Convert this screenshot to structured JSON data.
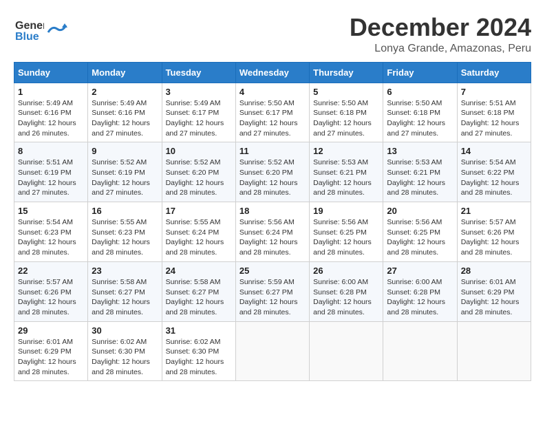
{
  "header": {
    "logo_line1": "General",
    "logo_line2": "Blue",
    "main_title": "December 2024",
    "subtitle": "Lonya Grande, Amazonas, Peru"
  },
  "calendar": {
    "days_of_week": [
      "Sunday",
      "Monday",
      "Tuesday",
      "Wednesday",
      "Thursday",
      "Friday",
      "Saturday"
    ],
    "weeks": [
      [
        {
          "day": "",
          "info": ""
        },
        {
          "day": "2",
          "info": "Sunrise: 5:49 AM\nSunset: 6:16 PM\nDaylight: 12 hours\nand 27 minutes."
        },
        {
          "day": "3",
          "info": "Sunrise: 5:49 AM\nSunset: 6:17 PM\nDaylight: 12 hours\nand 27 minutes."
        },
        {
          "day": "4",
          "info": "Sunrise: 5:50 AM\nSunset: 6:17 PM\nDaylight: 12 hours\nand 27 minutes."
        },
        {
          "day": "5",
          "info": "Sunrise: 5:50 AM\nSunset: 6:18 PM\nDaylight: 12 hours\nand 27 minutes."
        },
        {
          "day": "6",
          "info": "Sunrise: 5:50 AM\nSunset: 6:18 PM\nDaylight: 12 hours\nand 27 minutes."
        },
        {
          "day": "7",
          "info": "Sunrise: 5:51 AM\nSunset: 6:18 PM\nDaylight: 12 hours\nand 27 minutes."
        }
      ],
      [
        {
          "day": "1",
          "info": "Sunrise: 5:49 AM\nSunset: 6:16 PM\nDaylight: 12 hours\nand 26 minutes."
        },
        {
          "day": "9",
          "info": "Sunrise: 5:52 AM\nSunset: 6:19 PM\nDaylight: 12 hours\nand 27 minutes."
        },
        {
          "day": "10",
          "info": "Sunrise: 5:52 AM\nSunset: 6:20 PM\nDaylight: 12 hours\nand 28 minutes."
        },
        {
          "day": "11",
          "info": "Sunrise: 5:52 AM\nSunset: 6:20 PM\nDaylight: 12 hours\nand 28 minutes."
        },
        {
          "day": "12",
          "info": "Sunrise: 5:53 AM\nSunset: 6:21 PM\nDaylight: 12 hours\nand 28 minutes."
        },
        {
          "day": "13",
          "info": "Sunrise: 5:53 AM\nSunset: 6:21 PM\nDaylight: 12 hours\nand 28 minutes."
        },
        {
          "day": "14",
          "info": "Sunrise: 5:54 AM\nSunset: 6:22 PM\nDaylight: 12 hours\nand 28 minutes."
        }
      ],
      [
        {
          "day": "8",
          "info": "Sunrise: 5:51 AM\nSunset: 6:19 PM\nDaylight: 12 hours\nand 27 minutes."
        },
        {
          "day": "16",
          "info": "Sunrise: 5:55 AM\nSunset: 6:23 PM\nDaylight: 12 hours\nand 28 minutes."
        },
        {
          "day": "17",
          "info": "Sunrise: 5:55 AM\nSunset: 6:24 PM\nDaylight: 12 hours\nand 28 minutes."
        },
        {
          "day": "18",
          "info": "Sunrise: 5:56 AM\nSunset: 6:24 PM\nDaylight: 12 hours\nand 28 minutes."
        },
        {
          "day": "19",
          "info": "Sunrise: 5:56 AM\nSunset: 6:25 PM\nDaylight: 12 hours\nand 28 minutes."
        },
        {
          "day": "20",
          "info": "Sunrise: 5:56 AM\nSunset: 6:25 PM\nDaylight: 12 hours\nand 28 minutes."
        },
        {
          "day": "21",
          "info": "Sunrise: 5:57 AM\nSunset: 6:26 PM\nDaylight: 12 hours\nand 28 minutes."
        }
      ],
      [
        {
          "day": "15",
          "info": "Sunrise: 5:54 AM\nSunset: 6:23 PM\nDaylight: 12 hours\nand 28 minutes."
        },
        {
          "day": "23",
          "info": "Sunrise: 5:58 AM\nSunset: 6:27 PM\nDaylight: 12 hours\nand 28 minutes."
        },
        {
          "day": "24",
          "info": "Sunrise: 5:58 AM\nSunset: 6:27 PM\nDaylight: 12 hours\nand 28 minutes."
        },
        {
          "day": "25",
          "info": "Sunrise: 5:59 AM\nSunset: 6:27 PM\nDaylight: 12 hours\nand 28 minutes."
        },
        {
          "day": "26",
          "info": "Sunrise: 6:00 AM\nSunset: 6:28 PM\nDaylight: 12 hours\nand 28 minutes."
        },
        {
          "day": "27",
          "info": "Sunrise: 6:00 AM\nSunset: 6:28 PM\nDaylight: 12 hours\nand 28 minutes."
        },
        {
          "day": "28",
          "info": "Sunrise: 6:01 AM\nSunset: 6:29 PM\nDaylight: 12 hours\nand 28 minutes."
        }
      ],
      [
        {
          "day": "22",
          "info": "Sunrise: 5:57 AM\nSunset: 6:26 PM\nDaylight: 12 hours\nand 28 minutes."
        },
        {
          "day": "30",
          "info": "Sunrise: 6:02 AM\nSunset: 6:30 PM\nDaylight: 12 hours\nand 28 minutes."
        },
        {
          "day": "31",
          "info": "Sunrise: 6:02 AM\nSunset: 6:30 PM\nDaylight: 12 hours\nand 28 minutes."
        },
        {
          "day": "",
          "info": ""
        },
        {
          "day": "",
          "info": ""
        },
        {
          "day": "",
          "info": ""
        },
        {
          "day": ""
        }
      ],
      [
        {
          "day": "29",
          "info": "Sunrise: 6:01 AM\nSunset: 6:29 PM\nDaylight: 12 hours\nand 28 minutes."
        },
        {
          "day": "",
          "info": ""
        },
        {
          "day": "",
          "info": ""
        },
        {
          "day": "",
          "info": ""
        },
        {
          "day": "",
          "info": ""
        },
        {
          "day": "",
          "info": ""
        },
        {
          "day": "",
          "info": ""
        }
      ]
    ]
  }
}
